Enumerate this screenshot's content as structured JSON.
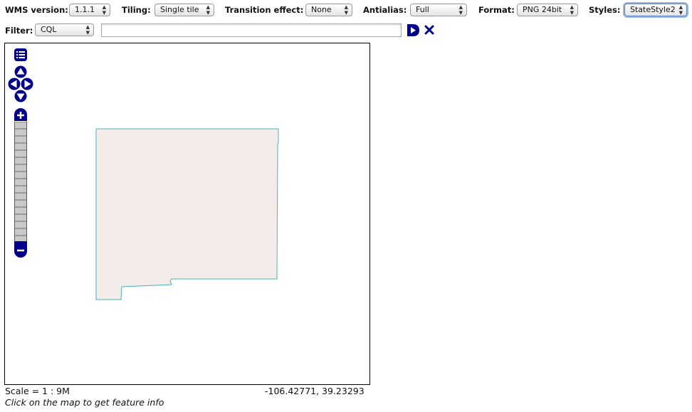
{
  "toolbar": {
    "wms_version": {
      "label": "WMS version:",
      "value": "1.1.1"
    },
    "tiling": {
      "label": "Tiling:",
      "value": "Single tile"
    },
    "transition": {
      "label": "Transition effect:",
      "value": "None"
    },
    "antialias": {
      "label": "Antialias:",
      "value": "Full"
    },
    "format": {
      "label": "Format:",
      "value": "PNG 24bit"
    },
    "styles": {
      "label": "Styles:",
      "value": "StateStyle2"
    },
    "filter": {
      "label": "Filter:",
      "value": "CQL",
      "text": ""
    }
  },
  "icons": {
    "apply_filter": "play-icon",
    "reset_filter": "close-icon",
    "layer_switcher": "layer-list-icon",
    "pan": "pan-arrows-icon",
    "zoom_in": "plus-icon",
    "zoom_out": "minus-icon"
  },
  "colors": {
    "control_blue": "#00008b",
    "state_fill": "#f3ece8",
    "state_stroke": "#4fb0c0"
  },
  "status": {
    "scale": "Scale = 1 : 9M",
    "coords": "-106.42771, 39.23293",
    "hint": "Click on the map to get feature info"
  }
}
